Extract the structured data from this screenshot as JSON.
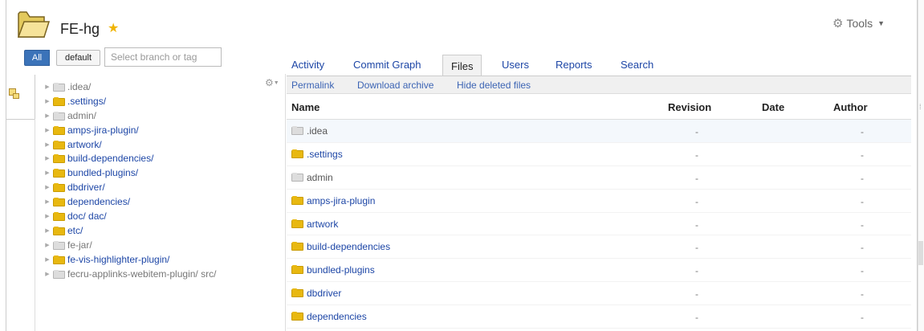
{
  "header": {
    "repo_name": "FE-hg",
    "tools_label": "Tools"
  },
  "branch": {
    "all_label": "All",
    "default_label": "default",
    "placeholder": "Select branch or tag"
  },
  "tree": {
    "items": [
      {
        "label": ".idea/",
        "active": false
      },
      {
        "label": ".settings/",
        "active": true
      },
      {
        "label": "admin/",
        "active": false
      },
      {
        "label": "amps-jira-plugin/",
        "active": true
      },
      {
        "label": "artwork/",
        "active": true
      },
      {
        "label": "build-dependencies/",
        "active": true
      },
      {
        "label": "bundled-plugins/",
        "active": true
      },
      {
        "label": "dbdriver/",
        "active": true
      },
      {
        "label": "dependencies/",
        "active": true
      },
      {
        "label": "doc/ dac/",
        "active": true
      },
      {
        "label": "etc/",
        "active": true
      },
      {
        "label": "fe-jar/",
        "active": false
      },
      {
        "label": "fe-vis-highlighter-plugin/",
        "active": true
      },
      {
        "label": "fecru-applinks-webitem-plugin/ src/",
        "active": false
      }
    ]
  },
  "tabs": [
    {
      "label": "Activity"
    },
    {
      "label": "Commit Graph"
    },
    {
      "label": "Files"
    },
    {
      "label": "Users"
    },
    {
      "label": "Reports"
    },
    {
      "label": "Search"
    }
  ],
  "subbar": {
    "permalink": "Permalink",
    "download": "Download archive",
    "hide_deleted": "Hide deleted files"
  },
  "table": {
    "headers": {
      "name": "Name",
      "revision": "Revision",
      "date": "Date",
      "author": "Author"
    },
    "rows": [
      {
        "name": ".idea",
        "active": false,
        "revision": "-",
        "date": "",
        "author": "-"
      },
      {
        "name": ".settings",
        "active": true,
        "revision": "-",
        "date": "",
        "author": "-"
      },
      {
        "name": "admin",
        "active": false,
        "revision": "-",
        "date": "",
        "author": "-"
      },
      {
        "name": "amps-jira-plugin",
        "active": true,
        "revision": "-",
        "date": "",
        "author": "-"
      },
      {
        "name": "artwork",
        "active": true,
        "revision": "-",
        "date": "",
        "author": "-"
      },
      {
        "name": "build-dependencies",
        "active": true,
        "revision": "-",
        "date": "",
        "author": "-"
      },
      {
        "name": "bundled-plugins",
        "active": true,
        "revision": "-",
        "date": "",
        "author": "-"
      },
      {
        "name": "dbdriver",
        "active": true,
        "revision": "-",
        "date": "",
        "author": "-"
      },
      {
        "name": "dependencies",
        "active": true,
        "revision": "-",
        "date": "",
        "author": "-"
      }
    ]
  },
  "colors": {
    "link": "#1d46a6",
    "folder": "#e8b810",
    "folder_inactive": "#dddddd",
    "all_button": "#3b73b9",
    "star": "#f0b400"
  },
  "icons": {
    "repo": "folder-open-icon",
    "favorite": "star-icon",
    "tools": "gear-icon",
    "tree_settings": "gear-icon",
    "tree_toggle": "tree-icon"
  }
}
